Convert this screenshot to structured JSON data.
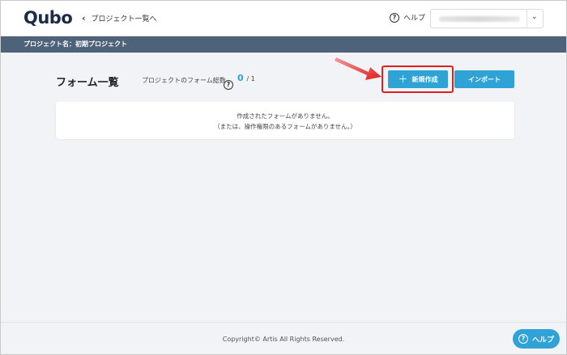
{
  "header": {
    "logo": "Qubo",
    "back_link": "プロジェクト一覧へ",
    "help": "ヘルプ",
    "user_email": ""
  },
  "project_bar": {
    "label": "プロジェクト名：初期プロジェクト"
  },
  "main": {
    "title": "フォーム一覧",
    "total_label": "プロジェクトのフォーム総数",
    "total_count": "0",
    "total_max": "/ 1",
    "new_button": "新規作成",
    "import_button": "インポート",
    "empty_line1": "作成されたフォームがありません。",
    "empty_line2": "（または、操作権限のあるフォームがありません。）"
  },
  "footer": {
    "copyright": "Copyright© Artis All Rights Reserved.",
    "help_button": "ヘルプ"
  },
  "colors": {
    "accent": "#2fa3d6",
    "project_bar": "#4e637a",
    "highlight": "#e02020"
  }
}
